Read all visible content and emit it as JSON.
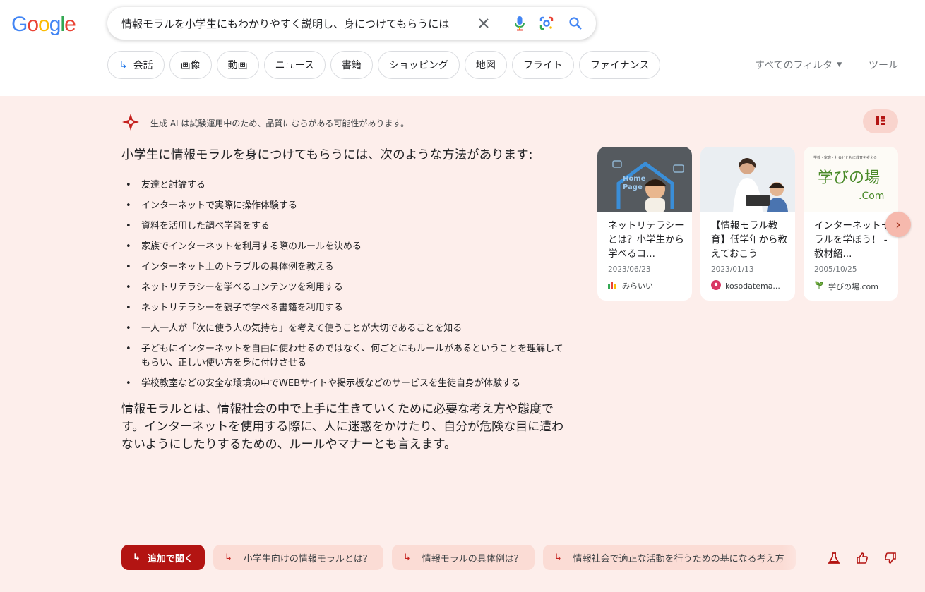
{
  "logo": {
    "text": "Google"
  },
  "search": {
    "query": "情報モラルを小学生にもわかりやすく説明し、身につけてもらうには"
  },
  "tabs": [
    {
      "label": "会話",
      "icon": "return-arrow-icon"
    },
    {
      "label": "画像"
    },
    {
      "label": "動画"
    },
    {
      "label": "ニュース"
    },
    {
      "label": "書籍"
    },
    {
      "label": "ショッピング"
    },
    {
      "label": "地図"
    },
    {
      "label": "フライト"
    },
    {
      "label": "ファイナンス"
    }
  ],
  "filters": {
    "all_filters": "すべてのフィルタ",
    "tools": "ツール"
  },
  "ai": {
    "notice": "生成 AI は試験運用中のため、品質にむらがある可能性があります。",
    "lead": "小学生に情報モラルを身につけてもらうには、次のような方法があります:",
    "items": [
      "友達と討論する",
      "インターネットで実際に操作体験する",
      "資料を活用した調べ学習をする",
      "家族でインターネットを利用する際のルールを決める",
      "インターネット上のトラブルの具体例を教える",
      "ネットリテラシーを学べるコンテンツを利用する",
      "ネットリテラシーを親子で学べる書籍を利用する",
      "一人一人が「次に使う人の気持ち」を考えて使うことが大切であることを知る",
      "子どもにインターネットを自由に使わせるのではなく、何ごとにもルールがあるということを理解してもらい、正しい使い方を身に付けさせる",
      "学校教室などの安全な環境の中でWEBサイトや掲示板などのサービスを生徒自身が体験する"
    ],
    "paragraph": "情報モラルとは、情報社会の中で上手に生きていくために必要な考え方や態度です。インターネットを使用する際に、人に迷惑をかけたり、自分が危険な目に遭わないようにしたりするための、ルールやマナーとも言えます。",
    "accent": "#b31412"
  },
  "cards": [
    {
      "title": "ネットリテラシーとは？小学生から学べるコ...",
      "date": "2023/06/23",
      "source": "みらいい",
      "image_text": "Home Page"
    },
    {
      "title": "【情報モラル教育】低学年から教えておこう",
      "date": "2023/01/13",
      "source": "kosodatema..."
    },
    {
      "title": "インターネットモラルを学ぼう！ - 教材紹...",
      "date": "2005/10/25",
      "source": "学びの場.com",
      "image_top": "学校・家庭・社会とともに教育を考える",
      "image_logo": "学びの場",
      "image_com": ".Com"
    }
  ],
  "followups": {
    "primary": "追加で聞く",
    "items": [
      "小学生向けの情報モラルとは？",
      "情報モラルの具体例は？",
      "情報社会で適正な活動を行うための基になる考え方"
    ]
  }
}
